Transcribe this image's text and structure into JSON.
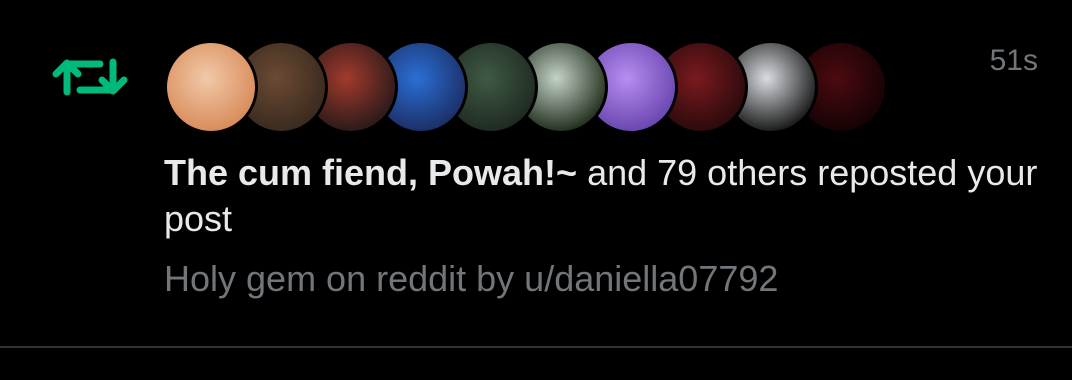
{
  "notification": {
    "timestamp": "51s",
    "actor_name": "The cum fiend, Powah!~",
    "action_text": " and 79 others reposted your post",
    "post_preview": "Holy gem on reddit by u/daniella07792",
    "icon": "repost-icon",
    "accent_color": "#00ba7c",
    "avatars": [
      {
        "name": "avatar-1",
        "colors": [
          "#f1c9a8",
          "#d98b5a"
        ]
      },
      {
        "name": "avatar-2",
        "colors": [
          "#6b4a33",
          "#3a2a1f"
        ]
      },
      {
        "name": "avatar-3",
        "colors": [
          "#a33a2c",
          "#2a1a1a"
        ]
      },
      {
        "name": "avatar-4",
        "colors": [
          "#2a6fd6",
          "#1c2f66"
        ]
      },
      {
        "name": "avatar-5",
        "colors": [
          "#3f5a44",
          "#1f2a22"
        ]
      },
      {
        "name": "avatar-6",
        "colors": [
          "#c4d3c8",
          "#23301f"
        ]
      },
      {
        "name": "avatar-7",
        "colors": [
          "#b78df0",
          "#6a46b0"
        ]
      },
      {
        "name": "avatar-8",
        "colors": [
          "#7a1a1e",
          "#2a0a0c"
        ]
      },
      {
        "name": "avatar-9",
        "colors": [
          "#d9dde2",
          "#1a1a1a"
        ]
      },
      {
        "name": "avatar-10",
        "colors": [
          "#6e0f16",
          "#1d0407"
        ]
      }
    ]
  }
}
